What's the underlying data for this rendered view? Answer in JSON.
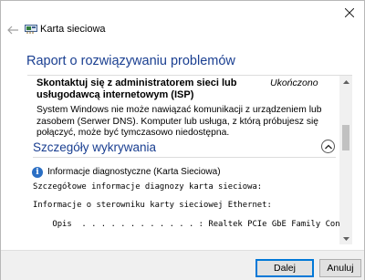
{
  "window": {
    "app_title": "Karta sieciowa",
    "icons": {
      "close": "close-icon",
      "back": "back-arrow-icon",
      "app": "network-adapter-icon"
    }
  },
  "report": {
    "title": "Raport o rozwiązywaniu problemów",
    "issue": {
      "title": "Skontaktuj się z administratorem sieci lub usługodawcą internetowym (ISP)",
      "status": "Ukończono",
      "description": "System Windows nie może nawiązać komunikacji z urządzeniem lub zasobem (Serwer DNS). Komputer lub usługa, z którą próbujesz się połączyć, może być tymczasowo niedostępna."
    },
    "details": {
      "section_title": "Szczegóły wykrywania",
      "info_label": "Informacje diagnostyczne (Karta Sieciowa)",
      "lines": [
        "Szczegółowe informacje diagnozy karta sieciowa:",
        "Informacje o sterowniku karty sieciowej Ethernet:",
        "    Opis  . . . . . . . . . . . . : Realtek PCIe GbE Family Controller"
      ]
    }
  },
  "footer": {
    "next_label": "Dalej",
    "cancel_label": "Anuluj"
  }
}
